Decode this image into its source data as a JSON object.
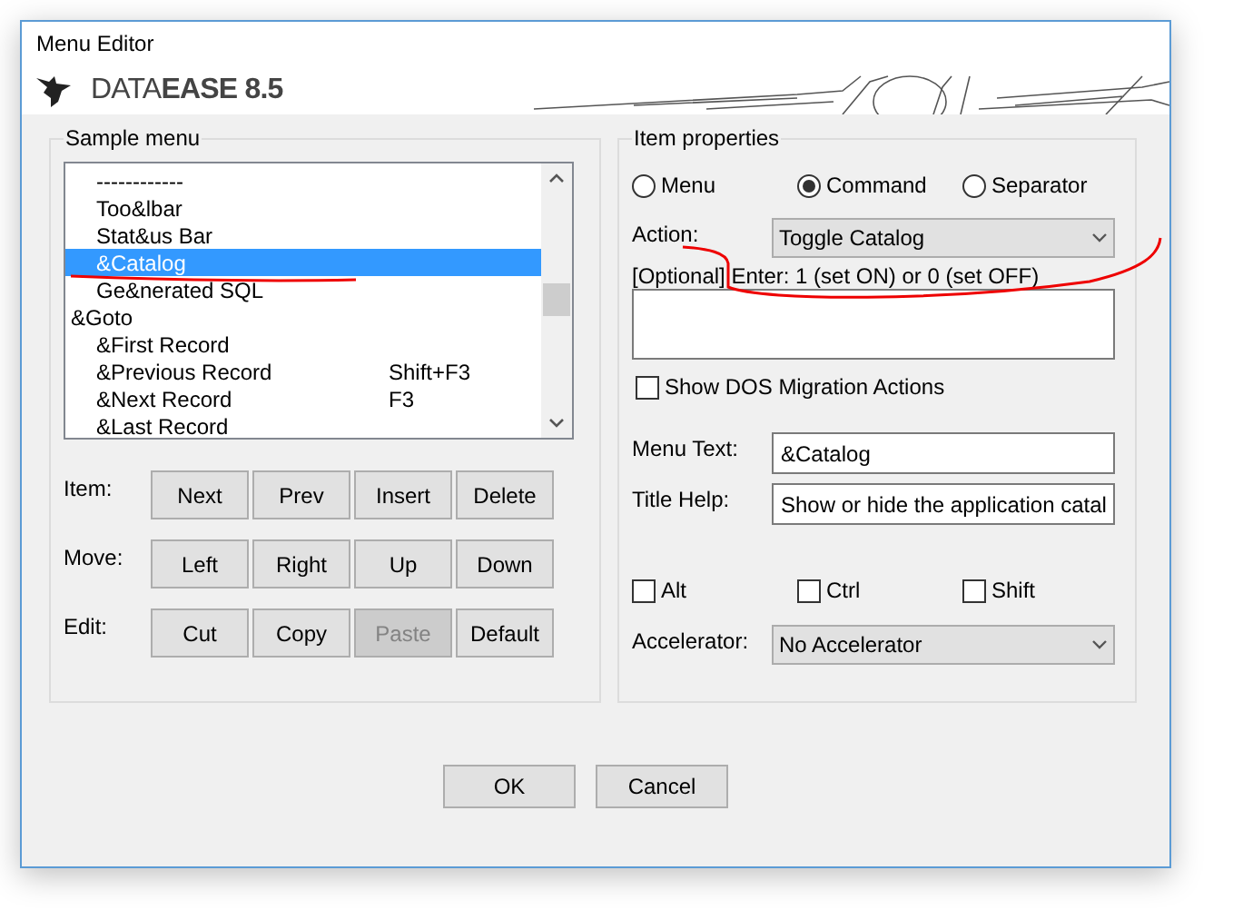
{
  "window": {
    "title": "Menu Editor"
  },
  "banner": {
    "logo_text": "DATA**EASE 8.5**"
  },
  "sample_menu": {
    "title": "Sample menu",
    "items": [
      {
        "children": [
          {
            "label": "------------",
            "selected": false
          },
          {
            "label": "Too&lbar",
            "selected": false
          },
          {
            "label": "Stat&us Bar",
            "selected": false
          },
          {
            "label": "&Catalog",
            "selected": true
          },
          {
            "label": "Ge&nerated SQL",
            "selected": false
          }
        ]
      },
      {
        "label": "&Goto",
        "selected": false,
        "children": [
          {
            "label": "&First Record",
            "selected": false
          },
          {
            "label": "&Previous Record",
            "shortcut": "Shift+F3",
            "selected": false
          },
          {
            "label": "&Next Record",
            "shortcut": "F3",
            "selected": false
          },
          {
            "label": "&Last Record",
            "selected": false
          }
        ]
      }
    ]
  },
  "button_rows": [
    {
      "label": "Item:",
      "buttons": [
        {
          "label": "Next",
          "disabled": false
        },
        {
          "label": "Prev",
          "disabled": false
        },
        {
          "label": "Insert",
          "disabled": false
        },
        {
          "label": "Delete",
          "disabled": false
        }
      ]
    },
    {
      "label": "Move:",
      "buttons": [
        {
          "label": "Left",
          "disabled": false
        },
        {
          "label": "Right",
          "disabled": false
        },
        {
          "label": "Up",
          "disabled": false
        },
        {
          "label": "Down",
          "disabled": false
        }
      ]
    },
    {
      "label": "Edit:",
      "buttons": [
        {
          "label": "Cut",
          "disabled": false
        },
        {
          "label": "Copy",
          "disabled": false
        },
        {
          "label": "Paste",
          "disabled": true
        },
        {
          "label": "Default",
          "disabled": false
        }
      ]
    }
  ],
  "item_properties": {
    "title": "Item properties",
    "types": [
      {
        "label": "Menu",
        "selected": false
      },
      {
        "label": "Command",
        "selected": true
      },
      {
        "label": "Separator",
        "selected": false
      }
    ],
    "action": {
      "label": "Action:",
      "value": "Toggle Catalog"
    },
    "optional_label": "[Optional] Enter: 1 (set ON) or 0 (set OFF)",
    "show_dos": {
      "label": "Show DOS Migration Actions",
      "checked": false
    },
    "menu_text": {
      "label": "Menu Text:",
      "value": "&Catalog"
    },
    "title_help": {
      "label": "Title Help:",
      "value": "Show or hide the application catal"
    },
    "modifiers": [
      {
        "label": "Alt",
        "checked": false
      },
      {
        "label": "Ctrl",
        "checked": false
      },
      {
        "label": "Shift",
        "checked": false
      }
    ],
    "accelerator": {
      "label": "Accelerator:",
      "value": "No Accelerator"
    }
  },
  "buttons": [
    "OK",
    "Cancel"
  ]
}
